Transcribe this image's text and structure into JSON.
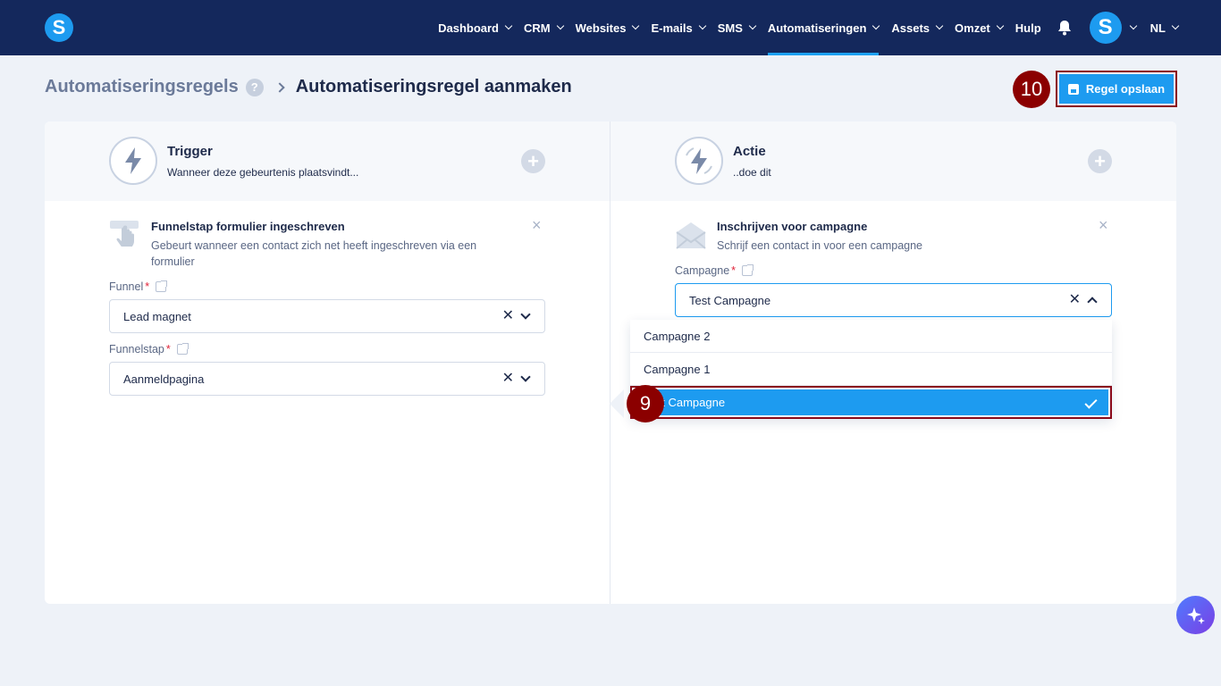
{
  "nav": {
    "items": [
      {
        "label": "Dashboard",
        "dropdown": true
      },
      {
        "label": "CRM",
        "dropdown": true
      },
      {
        "label": "Websites",
        "dropdown": true
      },
      {
        "label": "E-mails",
        "dropdown": true
      },
      {
        "label": "SMS",
        "dropdown": true
      },
      {
        "label": "Automatiseringen",
        "dropdown": true,
        "active": true
      },
      {
        "label": "Assets",
        "dropdown": true
      },
      {
        "label": "Omzet",
        "dropdown": true
      },
      {
        "label": "Hulp",
        "dropdown": false
      }
    ],
    "logo_letter": "S",
    "avatar_letter": "S",
    "language": "NL",
    "accent_color": "#1d9bf0",
    "bar_color": "#14285c"
  },
  "breadcrumb": {
    "parent": "Automatiseringsregels",
    "help": "?",
    "current": "Automatiseringsregel aanmaken"
  },
  "markers": {
    "save_marker": "10",
    "option_marker": "9"
  },
  "save_button": {
    "label": "Regel opslaan",
    "icon": "floppy-disk-icon"
  },
  "trigger": {
    "title": "Trigger",
    "subtitle": "Wanneer deze gebeurtenis plaatsvindt...",
    "item": {
      "icon": "hand-tap-icon",
      "title": "Funnelstap formulier ingeschreven",
      "description": "Gebeurt wanneer een contact zich net heeft ingeschreven via een formulier"
    },
    "fields": [
      {
        "label": "Funnel",
        "required": "*",
        "value": "Lead magnet"
      },
      {
        "label": "Funnelstap",
        "required": "*",
        "value": "Aanmeldpagina"
      }
    ]
  },
  "action": {
    "title": "Actie",
    "subtitle": "..doe dit",
    "item": {
      "icon": "envelope-icon",
      "title": "Inschrijven voor campagne",
      "description": "Schrijf een contact in voor een campagne"
    },
    "field": {
      "label": "Campagne",
      "required": "*",
      "value": "Test Campagne"
    },
    "options": [
      "Campagne 2",
      "Campagne 1",
      "Test Campagne"
    ],
    "selected_option": "Test Campagne"
  },
  "colors": {
    "marker": "#8b0000",
    "highlight_border": "#8b0a1a"
  }
}
